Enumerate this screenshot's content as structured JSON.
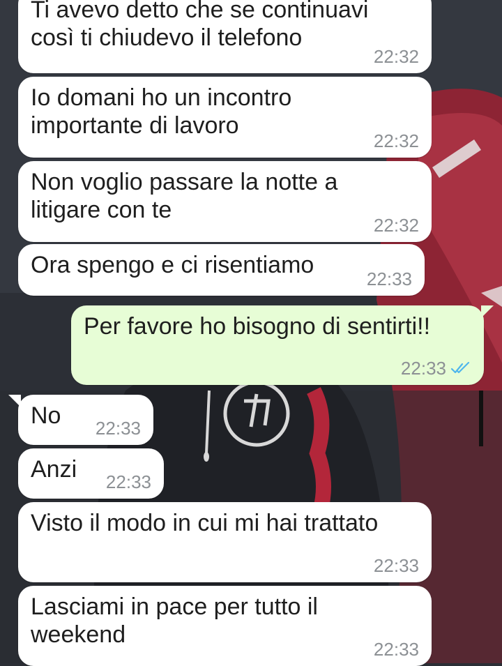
{
  "conversation": {
    "messages": [
      {
        "text": "Ti avevo detto che se continuavi\ncosì ti chiudevo il telefono",
        "time": "22:32"
      },
      {
        "text": "Io domani ho un incontro\nimportante di lavoro",
        "time": "22:32"
      },
      {
        "text": "Non voglio passare la notte a\nlitigare con te",
        "time": "22:32"
      },
      {
        "text": "Ora spengo e ci risentiamo",
        "time": "22:33"
      },
      {
        "text": "Per favore ho bisogno di sentirti!!",
        "time": "22:33",
        "status": "read-double-check-icon"
      },
      {
        "text": "No",
        "time": "22:33"
      },
      {
        "text": "Anzi",
        "time": "22:33"
      },
      {
        "text": "Visto il modo in cui mi hai trattato",
        "time": "22:33"
      },
      {
        "text": "Lasciami in pace per tutto il\nweekend",
        "time": "22:33"
      }
    ]
  },
  "colors": {
    "incoming_bubble": "#ffffff",
    "outgoing_bubble": "#e7fdd6",
    "read_ticks": "#4fb6ec",
    "timestamp": "#8c9094"
  }
}
